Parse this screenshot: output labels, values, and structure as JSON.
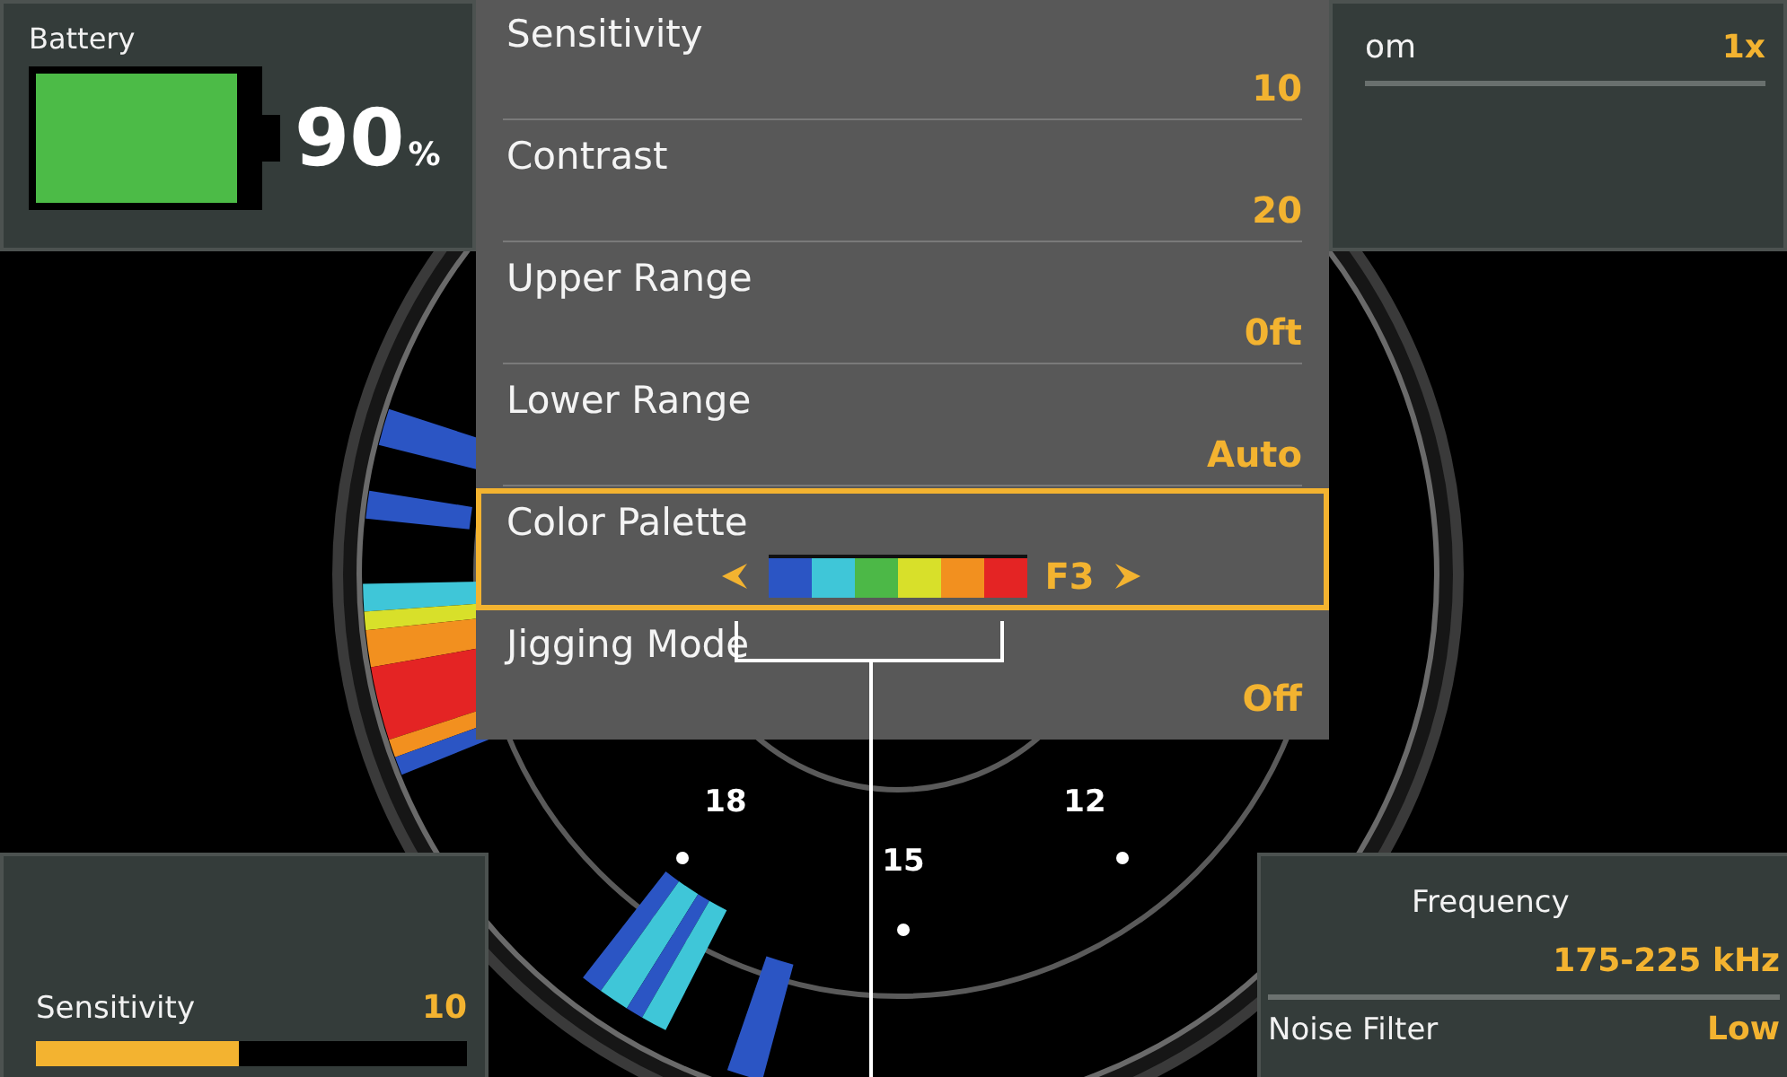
{
  "battery": {
    "label": "Battery",
    "value": "90",
    "unit": "%",
    "level": 0.92
  },
  "top_right": {
    "label": "om",
    "value": "1x"
  },
  "menu": {
    "items": [
      {
        "kind": "value",
        "label": "Sensitivity",
        "value": "10",
        "selected": false
      },
      {
        "kind": "value",
        "label": "Contrast",
        "value": "20",
        "selected": false
      },
      {
        "kind": "value",
        "label": "Upper Range",
        "value": "0ft",
        "selected": false
      },
      {
        "kind": "value",
        "label": "Lower Range",
        "value": "Auto",
        "selected": false
      },
      {
        "kind": "palette",
        "label": "Color Palette",
        "value": "F3",
        "selected": true,
        "palette": [
          {
            "color": "#2b55c4"
          },
          {
            "color": "#3fc6d8"
          },
          {
            "color": "#4cb847"
          },
          {
            "color": "#d8e02a"
          },
          {
            "color": "#f2901f"
          },
          {
            "color": "#e42424"
          }
        ]
      },
      {
        "kind": "value",
        "label": "Jigging Mode",
        "value": "Off",
        "selected": false
      }
    ]
  },
  "dial": {
    "labels": [
      "18",
      "15",
      "12"
    ]
  },
  "sensitivity": {
    "label": "Sensitivity",
    "value": "10",
    "level": 0.47
  },
  "bottom_right": {
    "rows": [
      {
        "label": "Frequency",
        "value": "175-225 kHz"
      },
      {
        "label": "Noise Filter",
        "value": "Low"
      }
    ]
  }
}
